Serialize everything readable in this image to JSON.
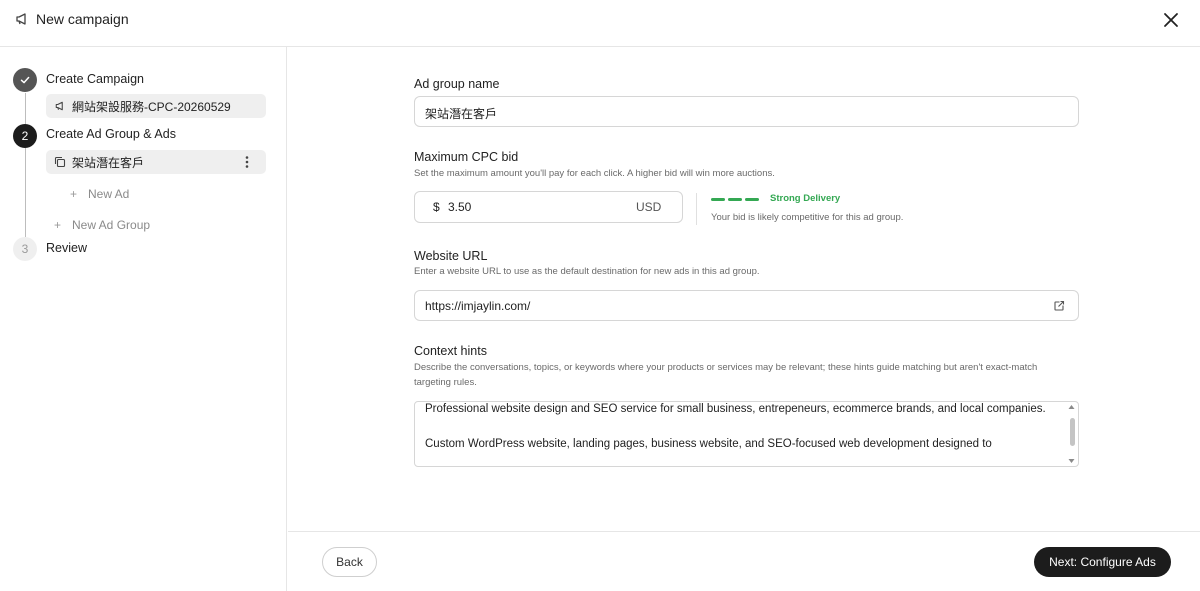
{
  "header": {
    "title": "New campaign",
    "icon": "megaphone-icon",
    "close_icon": "close-icon"
  },
  "sidebar": {
    "steps": [
      {
        "number": "1",
        "label": "Create Campaign",
        "state": "completed"
      },
      {
        "number": "2",
        "label": "Create Ad Group & Ads",
        "state": "active"
      },
      {
        "number": "3",
        "label": "Review",
        "state": "pending"
      }
    ],
    "campaign_item": {
      "label": "網站架設服務-CPC-20260529",
      "icon": "megaphone-icon"
    },
    "ad_group_item": {
      "label": "架站潛在客戶",
      "icon": "copy-icon"
    },
    "new_ad": "New Ad",
    "new_ad_group": "New Ad Group"
  },
  "form": {
    "ad_group_name": {
      "label": "Ad group name",
      "value": "架站潛在客戶"
    },
    "cpc_bid": {
      "label": "Maximum CPC bid",
      "description": "Set the maximum amount you'll pay for each click. A higher bid will win more auctions.",
      "currency_symbol": "$",
      "value": "3.50",
      "currency": "USD",
      "delivery_status": "Strong Delivery",
      "delivery_note": "Your bid is likely competitive for this ad group.",
      "delivery_level": 3,
      "delivery_color": "#34a853"
    },
    "website_url": {
      "label": "Website URL",
      "description": "Enter a website URL to use as the default destination for new ads in this ad group.",
      "value": "https://imjaylin.com/",
      "icon": "external-link-icon"
    },
    "context_hints": {
      "label": "Context hints",
      "description": "Describe the conversations, topics, or keywords where your products or services may be relevant; these hints guide matching but aren't exact-match targeting rules.",
      "value": "Professional website design and SEO service for small business, entrepeneurs, ecommerce brands, and local companies.\n\nCustom WordPress website, landing pages, business website, and SEO-focused web development designed to"
    }
  },
  "footer": {
    "back": "Back",
    "next": "Next: Configure Ads"
  }
}
